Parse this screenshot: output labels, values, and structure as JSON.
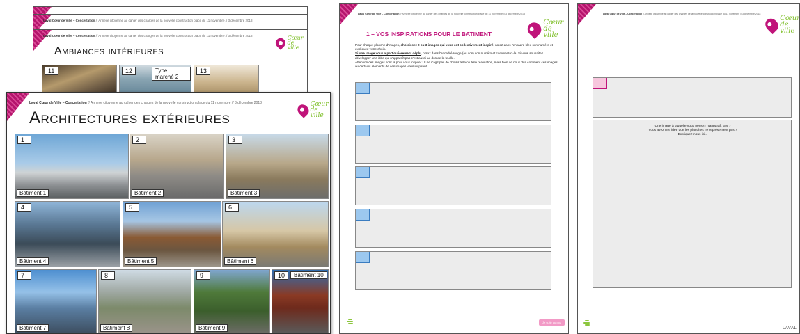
{
  "header_short": "Laval Cœur de Ville – Concertation",
  "header_rest": " // Annexe citoyenne au cahier des charges de la nouvelle construction place du 11 novembre // 3 décembre 2018",
  "logo": {
    "line1": "Cœur",
    "line2": "de ville"
  },
  "ambiances": {
    "title": "Ambiances intérieures",
    "tiles": [
      {
        "num": "11"
      },
      {
        "num": "12",
        "label": "Type marché 2"
      },
      {
        "num": "13"
      }
    ]
  },
  "architectures": {
    "title": "Architectures extérieures",
    "tiles": [
      {
        "num": "1",
        "caption": "Bâtiment 1"
      },
      {
        "num": "2",
        "caption": "Bâtiment 2"
      },
      {
        "num": "3",
        "caption": "Bâtiment 3"
      },
      {
        "num": "4",
        "caption": "Bâtiment 4"
      },
      {
        "num": "5",
        "caption": "Bâtiment 5"
      },
      {
        "num": "6",
        "caption": "Bâtiment 6"
      },
      {
        "num": "7",
        "caption": "Bâtiment 7"
      },
      {
        "num": "8",
        "caption": "Bâtiment 8"
      },
      {
        "num": "9",
        "caption": "Bâtiment 9"
      },
      {
        "num": "10",
        "caption": "Bâtiment 10"
      }
    ]
  },
  "inspirations": {
    "title": "1 – VOS INSPIRATIONS POUR LE BATIMENT",
    "p1a": "Pour chaque planche d'images, ",
    "p1b": "choisissez 2 ou 3 images qui vous ont collectivement inspiré",
    "p1c": ", notez dans l'encadré bleu son numéro et expliquez votre choix.",
    "p2a": "Si une image vous a particulièrement déplu",
    "p2b": ", notez dans l'encadré rouge (au dos) son numéro et commentez-la. Si vous souhaitez développer une idée qui n'apparaît pas c'est aussi au dos de la feuille.",
    "p3": "Attention ces images sont là pour vous inspirer ! Il ne s'agit pas de choisir telle ou telle réalisation, mais bien de nous dire comment ces images, ou certains éléments de ces images vous inspirent.",
    "next_button": "Je suite au dos"
  },
  "back_page": {
    "q1": "Une image à laquelle vous pensez n'apparaît pas ?",
    "q2": "Vous avez une idée que les planches ne représentent pas ?",
    "q3": "Expliquez-nous ici..."
  },
  "footer": {
    "laval": "LAVAL"
  },
  "colors": {
    "brand_pink": "#c0147a",
    "brand_green": "#7fbf2a",
    "slot_blue": "#9cc8ef",
    "slot_pink": "#f7c6dd"
  }
}
